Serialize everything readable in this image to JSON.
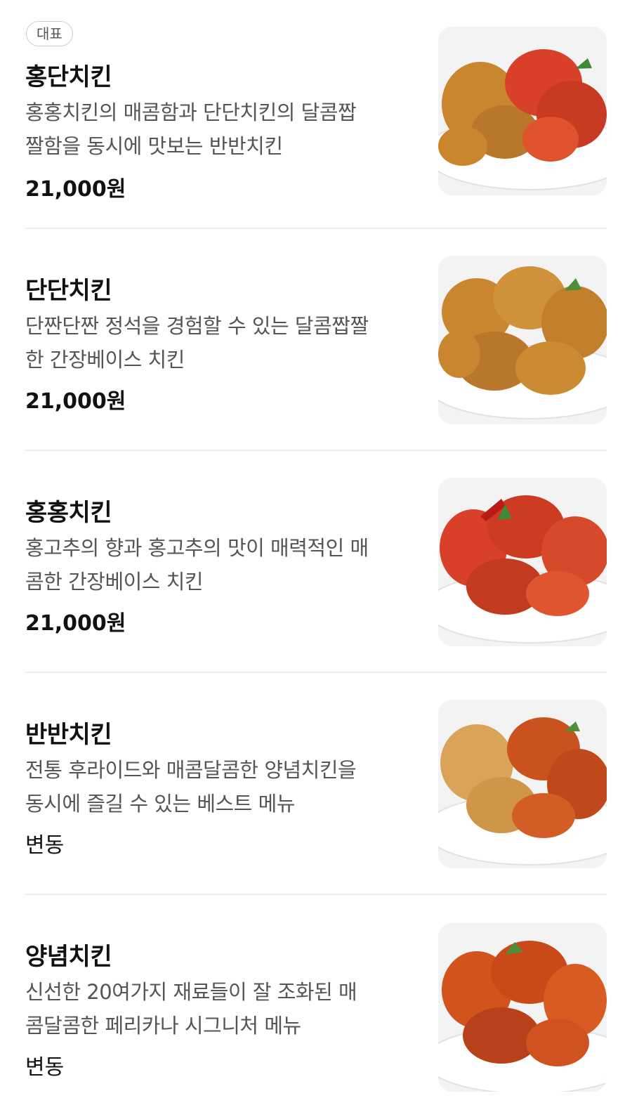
{
  "items": [
    {
      "badge": "대표",
      "name": "홍단치킨",
      "desc_line1": "홍홍치킨의 매콤함과 단단치킨의 달콤짭",
      "desc_line2": "짤함을 동시에 맛보는 반반치킨",
      "price": "21,000원",
      "image_icon": "honeydan-chicken-photo",
      "colors": [
        "#c9862f",
        "#d8402a"
      ]
    },
    {
      "name": "단단치킨",
      "desc_line1": "단짠단짠 정석을 경험할 수 있는 달콤짭짤",
      "desc_line2": "한 간장베이스 치킨",
      "price": "21,000원",
      "image_icon": "dandan-chicken-photo",
      "colors": [
        "#c9862f",
        "#b36e22"
      ]
    },
    {
      "name": "홍홍치킨",
      "desc_line1": "홍고추의 향과 홍고추의 맛이 매력적인 매",
      "desc_line2": "콤한 간장베이스 치킨",
      "price": "21,000원",
      "image_icon": "honghong-chicken-photo",
      "colors": [
        "#d8402a",
        "#c23a1f"
      ]
    },
    {
      "name": "반반치킨",
      "desc_line1": "전통 후라이드와 매콤달콤한 양념치킨을",
      "desc_line2": "동시에 즐길 수 있는 베스트 메뉴",
      "price": "변동",
      "image_icon": "banban-chicken-photo",
      "colors": [
        "#d9a35a",
        "#c9521f"
      ]
    },
    {
      "name": "양념치킨",
      "desc_line1": "신선한 20여가지 재료들이 잘 조화된 매",
      "desc_line2": "콤달콤한 페리카나 시그니처 메뉴",
      "price": "변동",
      "image_icon": "yangnyeom-chicken-photo",
      "colors": [
        "#d2541c",
        "#b8401a"
      ]
    }
  ]
}
